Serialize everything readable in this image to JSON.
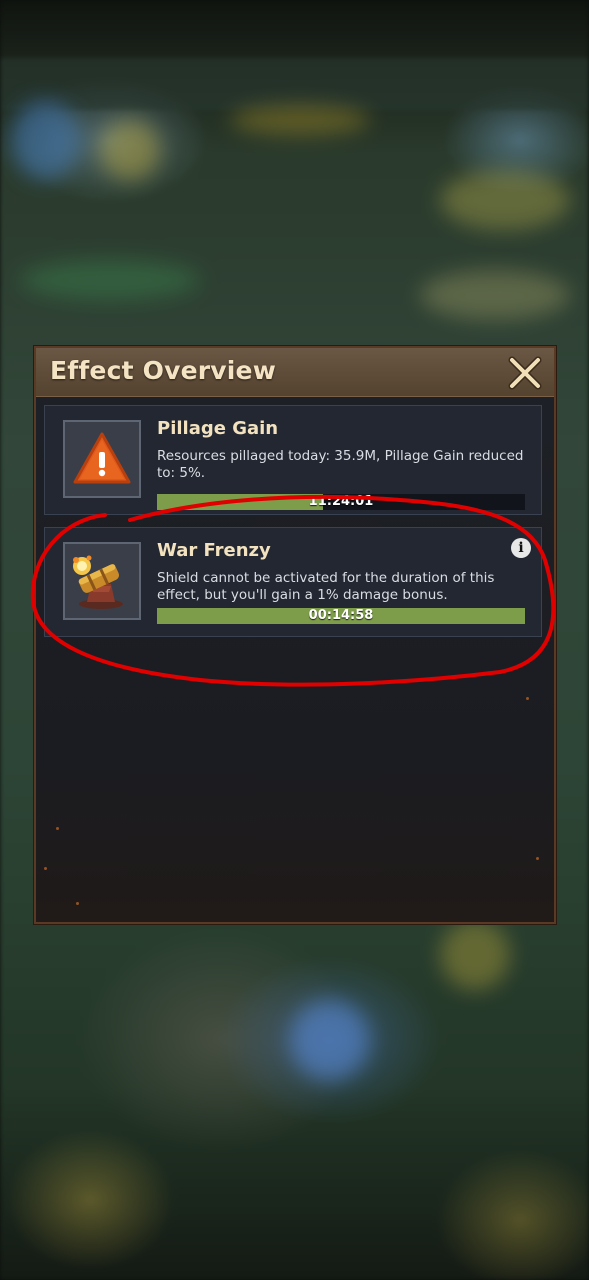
{
  "dialog": {
    "title": "Effect Overview",
    "close_icon": "close-x-icon"
  },
  "effects": [
    {
      "title": "Pillage Gain",
      "description": "Resources pillaged today: 35.9M, Pillage Gain reduced to: 5%.",
      "timer": "11:24:01",
      "progress": 0.45,
      "icon": "warning-triangle-icon",
      "has_info": false
    },
    {
      "title": "War Frenzy",
      "description": "Shield cannot be activated for the duration of this effect, but you'll gain a 1% damage bonus.",
      "timer": "00:14:58",
      "progress": 1.0,
      "icon": "cannon-icon",
      "has_info": true,
      "info_label": "i"
    }
  ],
  "colors": {
    "header": "#5f4d3a",
    "title_text": "#f5e4c4",
    "progress_fill": "#7d9d4a",
    "annotation_circle": "#e00000"
  }
}
